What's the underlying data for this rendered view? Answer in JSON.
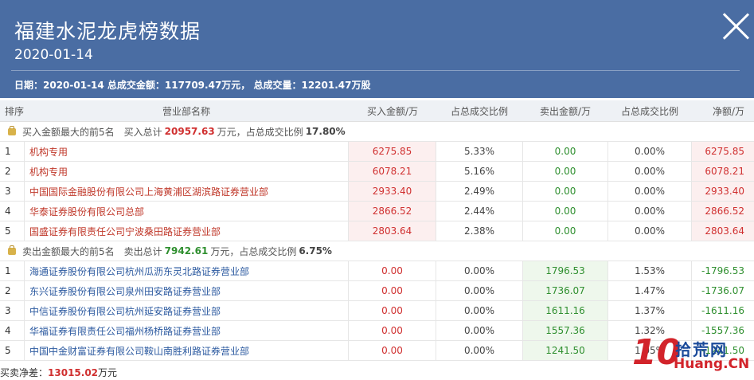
{
  "header": {
    "title": "福建水泥龙虎榜数据",
    "date": "2020-01-14",
    "summary": "日期：2020-01-14 总成交金额：117709.47万元， 总成交量：12201.47万股"
  },
  "columns": [
    "排序",
    "营业部名称",
    "买入金额/万",
    "占总成交比例",
    "卖出金额/万",
    "占总成交比例",
    "净额/万"
  ],
  "buy_section": {
    "label": "买入金额最大的前5名",
    "total_label": "买入总计",
    "total": "20957.63",
    "unit": "万元，占总成交比例",
    "ratio": "17.80%"
  },
  "buy_rows": [
    {
      "rank": "1",
      "name": "机构专用",
      "buy": "6275.85",
      "buy_pct": "5.33%",
      "sell": "0.00",
      "sell_pct": "0.00%",
      "net": "6275.85"
    },
    {
      "rank": "2",
      "name": "机构专用",
      "buy": "6078.21",
      "buy_pct": "5.16%",
      "sell": "0.00",
      "sell_pct": "0.00%",
      "net": "6078.21"
    },
    {
      "rank": "3",
      "name": "中国国际金融股份有限公司上海黄浦区湖滨路证券营业部",
      "buy": "2933.40",
      "buy_pct": "2.49%",
      "sell": "0.00",
      "sell_pct": "0.00%",
      "net": "2933.40"
    },
    {
      "rank": "4",
      "name": "华泰证券股份有限公司总部",
      "buy": "2866.52",
      "buy_pct": "2.44%",
      "sell": "0.00",
      "sell_pct": "0.00%",
      "net": "2866.52"
    },
    {
      "rank": "5",
      "name": "国盛证券有限责任公司宁波桑田路证券营业部",
      "buy": "2803.64",
      "buy_pct": "2.38%",
      "sell": "0.00",
      "sell_pct": "0.00%",
      "net": "2803.64"
    }
  ],
  "sell_section": {
    "label": "卖出金额最大的前5名",
    "total_label": "卖出总计",
    "total": "7942.61",
    "unit": "万元，占总成交比例",
    "ratio": "6.75%"
  },
  "sell_rows": [
    {
      "rank": "1",
      "name": "海通证券股份有限公司杭州瓜沥东灵北路证券营业部",
      "buy": "0.00",
      "buy_pct": "0.00%",
      "sell": "1796.53",
      "sell_pct": "1.53%",
      "net": "-1796.53"
    },
    {
      "rank": "2",
      "name": "东兴证券股份有限公司泉州田安路证券营业部",
      "buy": "0.00",
      "buy_pct": "0.00%",
      "sell": "1736.07",
      "sell_pct": "1.47%",
      "net": "-1736.07"
    },
    {
      "rank": "3",
      "name": "中信证券股份有限公司杭州延安路证券营业部",
      "buy": "0.00",
      "buy_pct": "0.00%",
      "sell": "1611.16",
      "sell_pct": "1.37%",
      "net": "-1611.16"
    },
    {
      "rank": "4",
      "name": "华福证券有限责任公司福州杨桥路证券营业部",
      "buy": "0.00",
      "buy_pct": "0.00%",
      "sell": "1557.36",
      "sell_pct": "1.32%",
      "net": "-1557.36"
    },
    {
      "rank": "5",
      "name": "中国中金财富证券有限公司鞍山南胜利路证券营业部",
      "buy": "0.00",
      "buy_pct": "0.00%",
      "sell": "1241.50",
      "sell_pct": "1.05%",
      "net": "-1241.50"
    }
  ],
  "footer": {
    "label": "买卖净差：",
    "value": "13015.02",
    "unit": "万元"
  },
  "watermark": {
    "num": "10",
    "cn": "拾荒网",
    "en": "Huang.CN"
  },
  "colors": {
    "header_bg": "#4a6da3",
    "buy": "#d03030",
    "sell": "#2f8f2f",
    "link": "#2c5aa0"
  }
}
